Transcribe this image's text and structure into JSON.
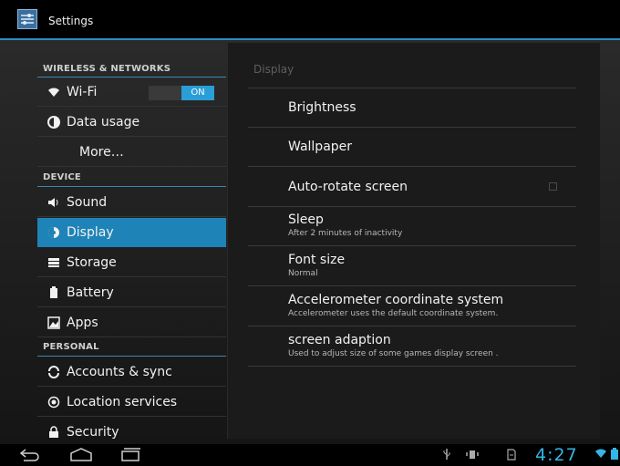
{
  "app": {
    "title": "Settings",
    "icon": "settings-icon"
  },
  "sidebar": {
    "sections": [
      {
        "header": "WIRELESS & NETWORKS"
      },
      {
        "header": "DEVICE"
      },
      {
        "header": "PERSONAL"
      }
    ],
    "items": [
      {
        "label": "Wi-Fi",
        "icon": "wifi-icon",
        "toggle": "ON"
      },
      {
        "label": "Data usage",
        "icon": "data-usage-icon"
      },
      {
        "label": "More…"
      },
      {
        "label": "Sound",
        "icon": "sound-icon"
      },
      {
        "label": "Display",
        "icon": "display-icon",
        "selected": true
      },
      {
        "label": "Storage",
        "icon": "storage-icon"
      },
      {
        "label": "Battery",
        "icon": "battery-icon"
      },
      {
        "label": "Apps",
        "icon": "apps-icon"
      },
      {
        "label": "Accounts & sync",
        "icon": "sync-icon"
      },
      {
        "label": "Location services",
        "icon": "location-icon"
      },
      {
        "label": "Security",
        "icon": "lock-icon"
      }
    ]
  },
  "display_panel": {
    "title": "Display",
    "options": [
      {
        "title": "Brightness"
      },
      {
        "title": "Wallpaper"
      },
      {
        "title": "Auto-rotate screen",
        "checked": false
      },
      {
        "title": "Sleep",
        "summary": "After 2 minutes of inactivity"
      },
      {
        "title": "Font size",
        "summary": "Normal"
      },
      {
        "title": "Accelerometer coordinate system",
        "summary": "Accelerometer uses the default coordinate system."
      },
      {
        "title": "screen adaption",
        "summary": "Used to adjust size of some games display screen ."
      }
    ]
  },
  "status_bar": {
    "time": "4:27"
  },
  "colors": {
    "accent": "#33b5e5",
    "selection": "#1e83b6",
    "action_bar": "#000000"
  }
}
